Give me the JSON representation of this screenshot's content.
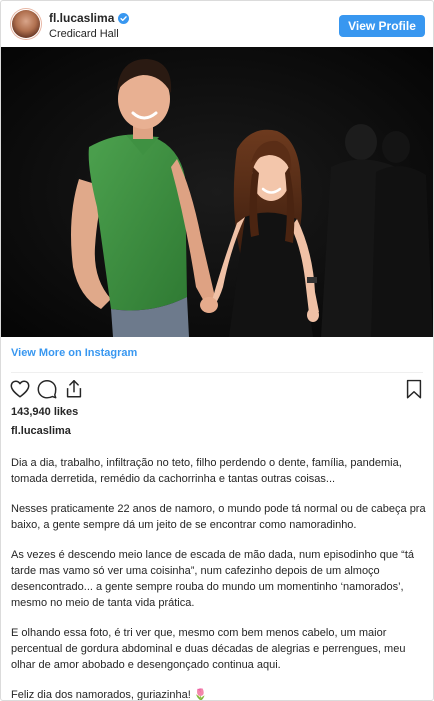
{
  "header": {
    "username": "fl.lucaslima",
    "location": "Credicard Hall",
    "view_profile_label": "View Profile"
  },
  "post": {
    "view_more_label": "View More on Instagram",
    "likes": "143,940 likes",
    "owner": "fl.lucaslima",
    "caption": [
      "Dia a dia, trabalho, infiltração no teto, filho perdendo o dente, família, pandemia, tomada derretida, remédio da cachorrinha e tantas outras coisas...",
      "Nesses praticamente 22 anos de namoro, o mundo pode tá normal ou de cabeça pra baixo, a gente sempre dá um jeito de se encontrar como namoradinho.",
      "As vezes é descendo meio lance de escada de mão dada, num episodinho que “tá tarde mas vamo só ver uma coisinha”, num cafezinho depois de um almoço desencontrado... a gente sempre rouba do mundo um momentinho ‘namorados’, mesmo no meio de tanta vida prática.",
      "E olhando essa foto, é tri ver que, mesmo com bem menos cabelo, um maior percentual de gordura abdominal e duas décadas de alegrias e perrengues, meu olhar de amor abobado e desengonçado continua aqui.",
      "Feliz dia dos namorados, guriazinha! 🌷"
    ]
  },
  "icons": {
    "verified": "verified-badge-icon",
    "like": "heart-icon",
    "comment": "comment-bubble-icon",
    "share": "share-icon",
    "save": "bookmark-icon"
  },
  "colors": {
    "accent": "#3897f0",
    "text": "#262626",
    "border": "#dbdbdb"
  }
}
